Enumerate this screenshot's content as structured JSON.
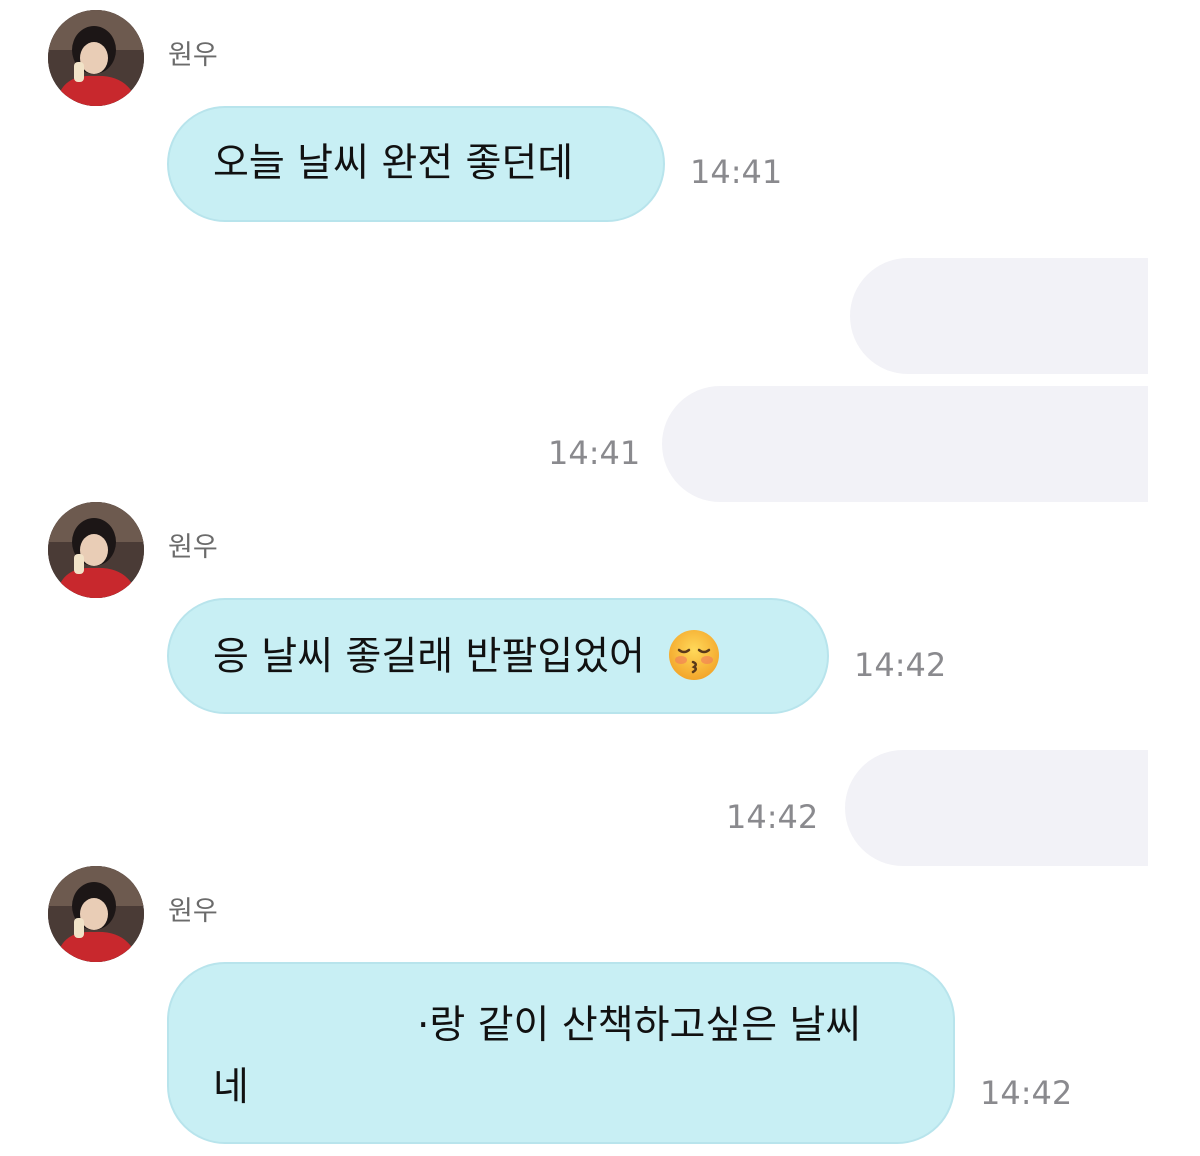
{
  "messages": [
    {
      "sender": "원우",
      "text": "오늘 날씨 완전 좋던데",
      "time": "14:41"
    },
    {
      "time": "14:41"
    },
    {
      "sender": "원우",
      "text": "응 날씨 좋길래 반팔입었어",
      "emoji": "kissing-face-with-closed-eyes-icon",
      "time": "14:42"
    },
    {
      "time": "14:42"
    },
    {
      "sender": "원우",
      "text_line1": "·랑 같이 산책하고싶은 날씨",
      "text_line2": "네",
      "time": "14:42"
    }
  ],
  "colors": {
    "incoming_bubble": "#c8eff4",
    "outgoing_bubble": "#f2f2f7",
    "timestamp": "#8a8a8e",
    "sender_name": "#6b6b6b"
  }
}
